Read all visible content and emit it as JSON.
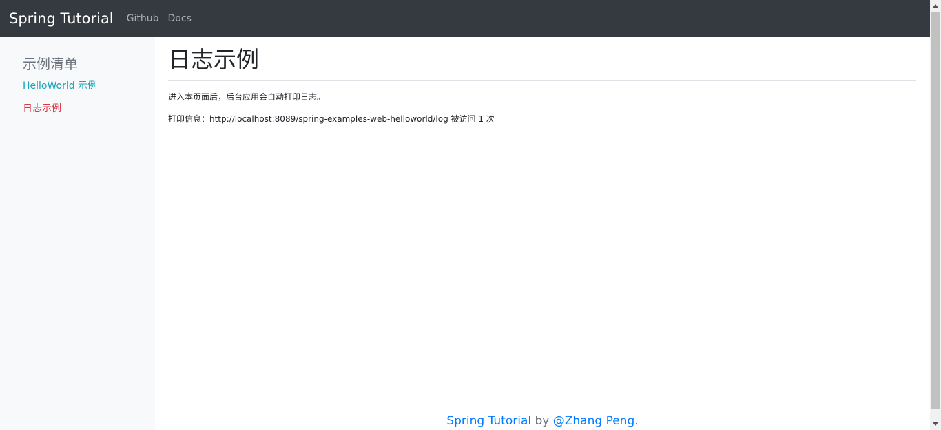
{
  "navbar": {
    "brand": "Spring Tutorial",
    "links": [
      "Github",
      "Docs"
    ]
  },
  "sidebar": {
    "title": "示例清单",
    "items": [
      {
        "label": "HelloWorld 示例",
        "color": "#17a2b8"
      },
      {
        "label": "日志示例",
        "color": "#dc3545",
        "active": true
      }
    ]
  },
  "main": {
    "title": "日志示例",
    "paragraphs": [
      "进入本页面后，后台应用会自动打印日志。",
      "打印信息：http://localhost:8089/spring-examples-web-helloworld/log 被访问 1 次"
    ]
  },
  "footer": {
    "project": "Spring Tutorial",
    "by": " by ",
    "author": "@Zhang Peng",
    "end": "."
  },
  "colors": {
    "navbar_bg": "#343a40",
    "sidebar_bg": "#f8f9fa",
    "link_blue": "#007bff"
  }
}
